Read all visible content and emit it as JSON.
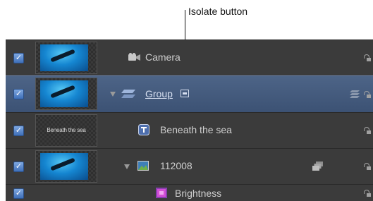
{
  "callout": {
    "label": "Isolate button"
  },
  "layers": [
    {
      "name": "Camera",
      "checked": true,
      "selected": false,
      "icon": "camera-icon"
    },
    {
      "name": "Group",
      "checked": true,
      "selected": true,
      "expanded": true,
      "icon": "group-layers-icon",
      "isolate_icon": "isolate-icon"
    },
    {
      "name": "Beneath the sea",
      "checked": true,
      "selected": false,
      "icon": "text-layer-icon",
      "thumbnail_text": "Beneath the sea"
    },
    {
      "name": "112008",
      "checked": true,
      "selected": false,
      "expanded": true,
      "icon": "image-layer-icon"
    },
    {
      "name": "Brightness",
      "checked": true,
      "selected": false,
      "icon": "filter-icon"
    }
  ],
  "checkmark": "✓",
  "colors": {
    "panel": "#3a3a3a",
    "selected_row": "#4d6487",
    "checkbox": "#3f6fb8"
  }
}
